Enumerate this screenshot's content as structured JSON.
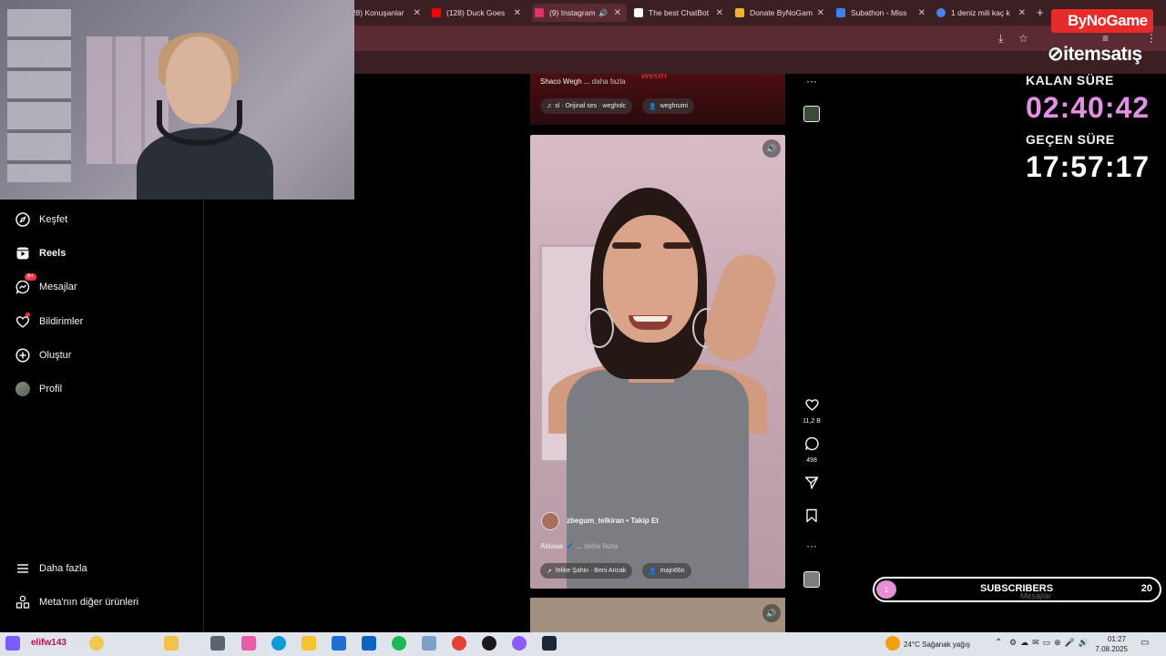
{
  "browser": {
    "tabs": [
      {
        "label": "(28) Konuşanlar",
        "color": "#5b8def"
      },
      {
        "label": "(128) Duck Goes",
        "color": "#ff0000"
      },
      {
        "label": "(9) Instagram",
        "color": "#e1306c"
      },
      {
        "label": "The best ChatBot",
        "color": "#ffffff"
      },
      {
        "label": "Donate ByNoGam",
        "color": "#f0b030"
      },
      {
        "label": "Subathon - Miss",
        "color": "#3b82f6"
      },
      {
        "label": "1 deniz mili kaç k",
        "color": "#4285f4"
      }
    ],
    "new_tab": "+"
  },
  "sidebar": {
    "items": [
      {
        "label": "Keşfet",
        "icon": "compass-icon"
      },
      {
        "label": "Reels",
        "icon": "reels-icon"
      },
      {
        "label": "Mesajlar",
        "icon": "messenger-icon",
        "badge": "9+"
      },
      {
        "label": "Bildirimler",
        "icon": "heart-icon"
      },
      {
        "label": "Oluştur",
        "icon": "plus-square-icon"
      },
      {
        "label": "Profil",
        "icon": "avatar"
      }
    ],
    "bottom": [
      {
        "label": "Daha fazla",
        "icon": "menu-icon"
      },
      {
        "label": "Meta'nın diğer ürünleri",
        "icon": "meta-apps-icon"
      }
    ]
  },
  "reels": {
    "prev": {
      "overlay_text": "weon",
      "caption": "Shaco Wegh ...",
      "more": "daha fazla",
      "audio": "sl · Orijinal ses · wegholc",
      "tag": "weghrumi"
    },
    "current": {
      "author": "zbegum_telkiran",
      "separator": "•",
      "follow": "Takip Et",
      "caption": "Ablaaa 🖊️ ...",
      "more": "daha fazla",
      "audio": "felike Şahin · Beni Ancak",
      "tag": "majn66n",
      "likes": "11,2 B",
      "comments": "498"
    }
  },
  "overlay": {
    "sponsor": "ByNoGame",
    "sponsor2": "itemsatış",
    "remaining_label": "KALAN SÜRE",
    "remaining_value": "02:40:42",
    "remaining_color": "#e58fe6",
    "elapsed_label": "GEÇEN SÜRE",
    "elapsed_value": "17:57:17",
    "elapsed_color": "#ffffff",
    "sub_goal_label": "SUBSCRIBERS",
    "sub_goal_current": "1",
    "sub_goal_target": "20",
    "sub_goal_ghost": "Mesajlar"
  },
  "taskbar": {
    "user_tag": "elifw143",
    "weather": "24°C",
    "weather_desc": "Sağanak yağış",
    "time": "01:27",
    "date": "7.08.2025"
  }
}
